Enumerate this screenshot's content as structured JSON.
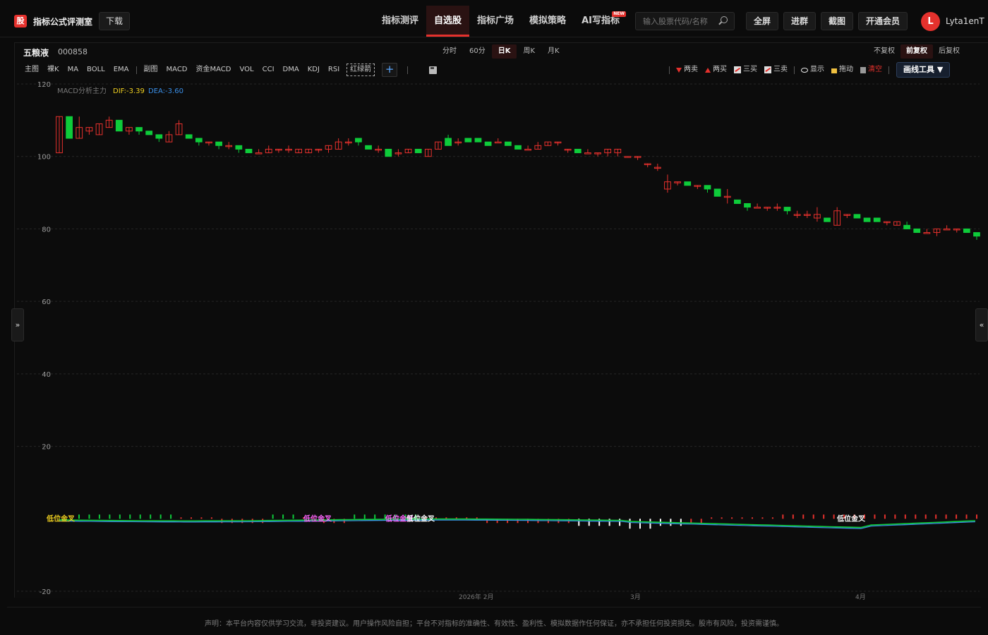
{
  "app": {
    "logo_glyph": "股",
    "title": "指标公式评测室",
    "download_label": "下载"
  },
  "nav": {
    "items": [
      {
        "label": "指标测评",
        "active": false
      },
      {
        "label": "自选股",
        "active": true
      },
      {
        "label": "指标广场",
        "active": false
      },
      {
        "label": "模拟策略",
        "active": false
      },
      {
        "label": "AI写指标",
        "active": false,
        "badge": "NEW"
      }
    ]
  },
  "search": {
    "placeholder": "输入股票代码/名称"
  },
  "toolbar": {
    "fullscreen": "全屏",
    "join_group": "进群",
    "screenshot": "截图",
    "membership": "开通会员"
  },
  "user": {
    "avatar_letter": "L",
    "name": "Lyta1enT"
  },
  "stock": {
    "name": "五粮液",
    "code": "000858"
  },
  "periods": [
    {
      "label": "分时",
      "active": false
    },
    {
      "label": "60分",
      "active": false
    },
    {
      "label": "日K",
      "active": true
    },
    {
      "label": "周K",
      "active": false
    },
    {
      "label": "月K",
      "active": false
    }
  ],
  "adjust": [
    {
      "label": "不复权",
      "active": false
    },
    {
      "label": "前复权",
      "active": true
    },
    {
      "label": "后复权",
      "active": false
    }
  ],
  "indicators_main": [
    "主图",
    "裸K",
    "MA",
    "BOLL",
    "EMA"
  ],
  "indicators_sub": [
    "副图",
    "MACD",
    "资金MACD",
    "VOL",
    "CCI",
    "DMA",
    "KDJ",
    "RSI"
  ],
  "indicator_custom": "红绿箭",
  "draw_tools": {
    "two_sell": "两卖",
    "two_buy": "两买",
    "three_buy": "三买",
    "three_sell": "三卖",
    "show": "显示",
    "drag": "拖动",
    "clear": "清空",
    "draw_tools_label": "画线工具 ▼"
  },
  "legend": {
    "name": "MACD分析主力",
    "dif": "DIF:-3.39",
    "dea": "DEA:-3.60",
    "dif_color": "#f0d020",
    "dea_color": "#3a8ee6"
  },
  "signals": [
    "低位金叉",
    "低位金叉",
    "低位金叉",
    "低位金叉",
    "低位金叉"
  ],
  "colors": {
    "up": "#e5312d",
    "down": "#0ecb3a",
    "accent": "#e5312d",
    "grid": "#262626"
  },
  "side_left": "»",
  "side_right": "«",
  "disclaimer": "声明：本平台内容仅供学习交流，非投资建议。用户操作风险自担；平台不对指标的准确性、有效性、盈利性、模拟数据作任何保证，亦不承担任何投资损失。股市有风险，投资需谨慎。",
  "chart_data": {
    "type": "candlestick",
    "y_ticks": [
      120,
      100,
      80,
      60,
      40,
      20,
      -20
    ],
    "ylim": [
      -20,
      120
    ],
    "x_tick_labels": [
      "2026年 2月",
      "3月",
      "4月"
    ],
    "candles": [
      {
        "o": 101,
        "c": 111,
        "h": 111,
        "l": 101
      },
      {
        "o": 111,
        "c": 105,
        "h": 111,
        "l": 105
      },
      {
        "o": 105,
        "c": 108,
        "h": 111,
        "l": 105
      },
      {
        "o": 107,
        "c": 108,
        "h": 108,
        "l": 106
      },
      {
        "o": 106,
        "c": 109,
        "h": 109,
        "l": 106
      },
      {
        "o": 108,
        "c": 110,
        "h": 111,
        "l": 108
      },
      {
        "o": 110,
        "c": 107,
        "h": 110,
        "l": 107
      },
      {
        "o": 107,
        "c": 108,
        "h": 108,
        "l": 106
      },
      {
        "o": 108,
        "c": 107,
        "h": 108,
        "l": 106
      },
      {
        "o": 107,
        "c": 106,
        "h": 107,
        "l": 106
      },
      {
        "o": 106,
        "c": 105,
        "h": 106,
        "l": 104
      },
      {
        "o": 104,
        "c": 106,
        "h": 107,
        "l": 104
      },
      {
        "o": 106,
        "c": 109,
        "h": 110,
        "l": 106
      },
      {
        "o": 106,
        "c": 105,
        "h": 106,
        "l": 105
      },
      {
        "o": 105,
        "c": 104,
        "h": 105,
        "l": 103
      },
      {
        "o": 104,
        "c": 104,
        "h": 104,
        "l": 103
      },
      {
        "o": 104,
        "c": 103,
        "h": 104,
        "l": 102
      },
      {
        "o": 103,
        "c": 103,
        "h": 104,
        "l": 102
      },
      {
        "o": 103,
        "c": 102,
        "h": 103,
        "l": 101
      },
      {
        "o": 102,
        "c": 101,
        "h": 102,
        "l": 101
      },
      {
        "o": 101,
        "c": 101,
        "h": 102,
        "l": 101
      },
      {
        "o": 101,
        "c": 102,
        "h": 103,
        "l": 101
      },
      {
        "o": 102,
        "c": 102,
        "h": 102,
        "l": 101
      },
      {
        "o": 102,
        "c": 102,
        "h": 103,
        "l": 101
      },
      {
        "o": 101,
        "c": 102,
        "h": 102,
        "l": 101
      },
      {
        "o": 101,
        "c": 102,
        "h": 102,
        "l": 101
      },
      {
        "o": 102,
        "c": 102,
        "h": 102,
        "l": 101
      },
      {
        "o": 102,
        "c": 103,
        "h": 103,
        "l": 101
      },
      {
        "o": 102,
        "c": 104,
        "h": 105,
        "l": 102
      },
      {
        "o": 104,
        "c": 104,
        "h": 105,
        "l": 103
      },
      {
        "o": 105,
        "c": 104,
        "h": 105,
        "l": 103
      },
      {
        "o": 103,
        "c": 102,
        "h": 103,
        "l": 102
      },
      {
        "o": 102,
        "c": 102,
        "h": 103,
        "l": 101
      },
      {
        "o": 102,
        "c": 100,
        "h": 102,
        "l": 100
      },
      {
        "o": 101,
        "c": 101,
        "h": 102,
        "l": 100
      },
      {
        "o": 101,
        "c": 102,
        "h": 102,
        "l": 101
      },
      {
        "o": 102,
        "c": 101,
        "h": 102,
        "l": 101
      },
      {
        "o": 100,
        "c": 102,
        "h": 102,
        "l": 100
      },
      {
        "o": 102,
        "c": 104,
        "h": 104,
        "l": 102
      },
      {
        "o": 105,
        "c": 103,
        "h": 106,
        "l": 103
      },
      {
        "o": 104,
        "c": 104,
        "h": 105,
        "l": 103
      },
      {
        "o": 105,
        "c": 104,
        "h": 105,
        "l": 104
      },
      {
        "o": 105,
        "c": 104,
        "h": 105,
        "l": 104
      },
      {
        "o": 104,
        "c": 103,
        "h": 104,
        "l": 103
      },
      {
        "o": 104,
        "c": 104,
        "h": 105,
        "l": 104
      },
      {
        "o": 104,
        "c": 103,
        "h": 104,
        "l": 103
      },
      {
        "o": 103,
        "c": 102,
        "h": 103,
        "l": 102
      },
      {
        "o": 102,
        "c": 102,
        "h": 103,
        "l": 102
      },
      {
        "o": 102,
        "c": 103,
        "h": 104,
        "l": 102
      },
      {
        "o": 103,
        "c": 104,
        "h": 104,
        "l": 103
      },
      {
        "o": 104,
        "c": 104,
        "h": 104,
        "l": 103
      },
      {
        "o": 102,
        "c": 102,
        "h": 102,
        "l": 101
      },
      {
        "o": 102,
        "c": 101,
        "h": 102,
        "l": 101
      },
      {
        "o": 101,
        "c": 101,
        "h": 102,
        "l": 101
      },
      {
        "o": 101,
        "c": 101,
        "h": 101,
        "l": 100
      },
      {
        "o": 101,
        "c": 102,
        "h": 102,
        "l": 100
      },
      {
        "o": 101,
        "c": 102,
        "h": 102,
        "l": 100
      },
      {
        "o": 100,
        "c": 100,
        "h": 100,
        "l": 100
      },
      {
        "o": 100,
        "c": 100,
        "h": 100,
        "l": 99
      },
      {
        "o": 98,
        "c": 98,
        "h": 98,
        "l": 97
      },
      {
        "o": 97,
        "c": 97,
        "h": 98,
        "l": 96
      },
      {
        "o": 91,
        "c": 93,
        "h": 95,
        "l": 90
      },
      {
        "o": 93,
        "c": 93,
        "h": 93,
        "l": 92
      },
      {
        "o": 93,
        "c": 92,
        "h": 93,
        "l": 92
      },
      {
        "o": 92,
        "c": 92,
        "h": 92,
        "l": 91
      },
      {
        "o": 92,
        "c": 91,
        "h": 92,
        "l": 90
      },
      {
        "o": 91,
        "c": 89,
        "h": 91,
        "l": 89
      },
      {
        "o": 89,
        "c": 89,
        "h": 91,
        "l": 87
      },
      {
        "o": 88,
        "c": 87,
        "h": 88,
        "l": 87
      },
      {
        "o": 87,
        "c": 86,
        "h": 87,
        "l": 85
      },
      {
        "o": 86,
        "c": 86,
        "h": 87,
        "l": 86
      },
      {
        "o": 86,
        "c": 86,
        "h": 86,
        "l": 85
      },
      {
        "o": 86,
        "c": 86,
        "h": 87,
        "l": 85
      },
      {
        "o": 86,
        "c": 85,
        "h": 86,
        "l": 84
      },
      {
        "o": 84,
        "c": 84,
        "h": 85,
        "l": 83
      },
      {
        "o": 84,
        "c": 84,
        "h": 85,
        "l": 83
      },
      {
        "o": 83,
        "c": 84,
        "h": 86,
        "l": 82
      },
      {
        "o": 83,
        "c": 82,
        "h": 83,
        "l": 82
      },
      {
        "o": 81,
        "c": 85,
        "h": 86,
        "l": 81
      },
      {
        "o": 84,
        "c": 84,
        "h": 84,
        "l": 83
      },
      {
        "o": 84,
        "c": 83,
        "h": 84,
        "l": 83
      },
      {
        "o": 83,
        "c": 82,
        "h": 83,
        "l": 82
      },
      {
        "o": 83,
        "c": 82,
        "h": 83,
        "l": 82
      },
      {
        "o": 82,
        "c": 82,
        "h": 82,
        "l": 81
      },
      {
        "o": 81,
        "c": 82,
        "h": 82,
        "l": 81
      },
      {
        "o": 81,
        "c": 80,
        "h": 82,
        "l": 80
      },
      {
        "o": 80,
        "c": 79,
        "h": 80,
        "l": 79
      },
      {
        "o": 79,
        "c": 79,
        "h": 80,
        "l": 79
      },
      {
        "o": 79,
        "c": 80,
        "h": 80,
        "l": 78
      },
      {
        "o": 80,
        "c": 80,
        "h": 81,
        "l": 80
      },
      {
        "o": 80,
        "c": 80,
        "h": 80,
        "l": 79
      },
      {
        "o": 80,
        "c": 79,
        "h": 80,
        "l": 79
      },
      {
        "o": 79,
        "c": 78,
        "h": 79,
        "l": 77
      }
    ],
    "macd_hist": [
      1,
      1,
      1,
      1,
      1,
      1,
      1,
      1,
      1,
      1,
      0,
      0,
      0,
      0,
      -1,
      -1,
      -1,
      -1,
      -1,
      1,
      1,
      1,
      0,
      0,
      -1,
      -1,
      -1,
      1,
      1,
      1,
      1,
      1,
      1,
      1,
      0,
      0,
      0,
      0,
      0,
      0,
      -1,
      -1,
      -1,
      -1,
      -1,
      -1,
      -1,
      -1,
      -1,
      -2,
      -2,
      -2,
      -2,
      -2,
      -3,
      -3,
      -3,
      -2,
      -2,
      -2,
      -1,
      -1,
      0,
      0,
      0,
      0,
      0,
      0,
      0,
      1,
      1,
      1,
      1,
      1,
      1,
      1,
      1,
      1,
      1,
      1,
      1,
      1,
      1,
      1,
      1,
      1,
      1,
      1,
      1
    ]
  }
}
